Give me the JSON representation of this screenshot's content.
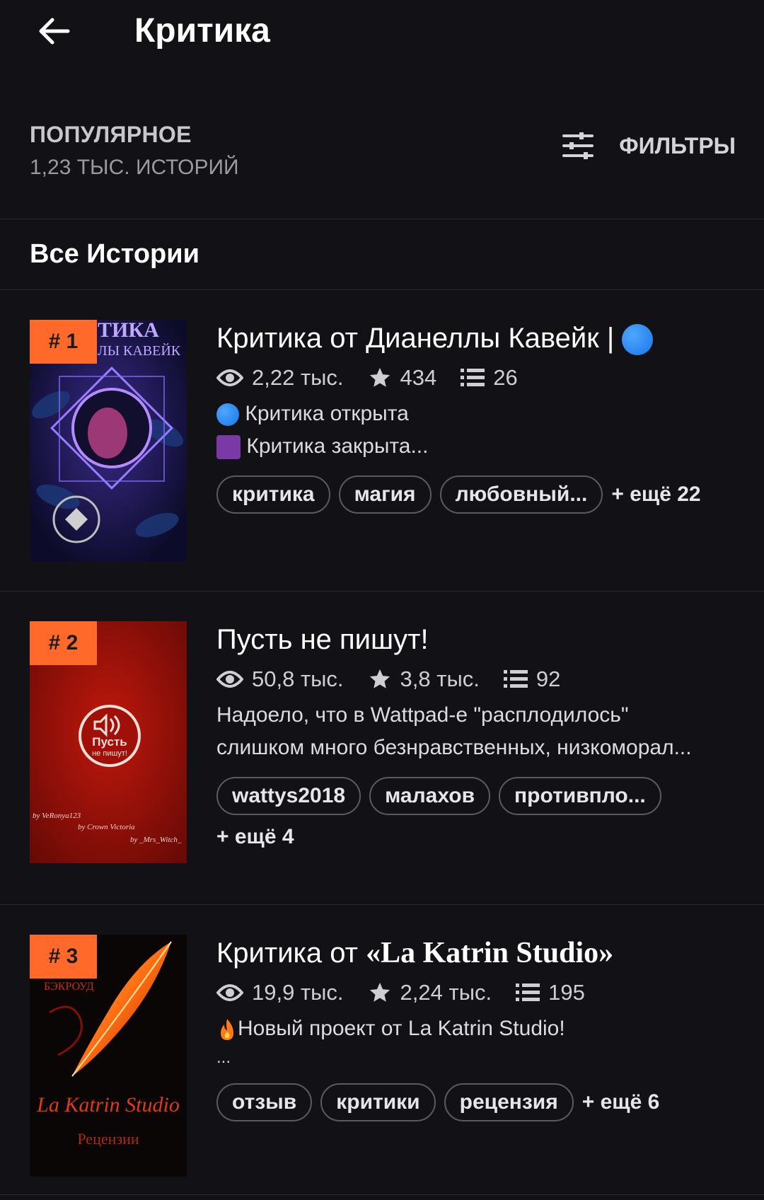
{
  "header": {
    "title": "Критика"
  },
  "sort": {
    "label": "ПОПУЛЯРНОЕ",
    "count": "1,23 ТЫС. ИСТОРИЙ",
    "filters_label": "ФИЛЬТРЫ"
  },
  "section": {
    "title": "Все Истории"
  },
  "stories": [
    {
      "rank": "# 1",
      "title": "Критика от Дианеллы Кавейк  |",
      "views": "2,22 тыс.",
      "votes": "434",
      "parts": "26",
      "desc_lines": [
        "Критика открыта",
        "Критика закрыта..."
      ],
      "tags": [
        "критика",
        "магия",
        "любовный..."
      ],
      "more": "+ ещё 22",
      "cover_text": [
        "ТИКА",
        "ЛЫ КАВЕЙК"
      ]
    },
    {
      "rank": "# 2",
      "title": "Пусть не пишут!",
      "views": "50,8 тыс.",
      "votes": "3,8 тыс.",
      "parts": "92",
      "desc_lines": [
        "Надоело, что в  Wattpad-е \"расплодилось\"",
        "слишком много безнравственных, низкоморал..."
      ],
      "tags": [
        "wattys2018",
        "малахов",
        "противпло..."
      ],
      "more": "+ ещё 4",
      "cover_text": [
        "Пусть",
        "не пишут!",
        "by VeRonya123",
        "by Crown Victoria",
        "by _Mrs_Witch_"
      ]
    },
    {
      "rank": "# 3",
      "title_prefix": "Критика от ",
      "title_styled": "«La Katrin Studio»",
      "views": "19,9 тыс.",
      "votes": "2,24 тыс.",
      "parts": "195",
      "desc_lines": [
        "Новый проект от La Katrin Studio!",
        "..."
      ],
      "tags": [
        "отзыв",
        "критики",
        "рецензия"
      ],
      "more": "+ ещё 6",
      "cover_text": [
        "БЭКРОУД",
        "La Katrin Studio",
        "Рецензии"
      ]
    }
  ],
  "colors": {
    "background": "#121115",
    "rank_badge": "#ff6a2b",
    "status_open": "#1f7ff0",
    "status_closed": "#7a3aa6"
  },
  "icons": [
    "arrow-left-icon",
    "filter-sliders-icon",
    "eye-icon",
    "star-icon",
    "list-icon",
    "fire-icon"
  ]
}
